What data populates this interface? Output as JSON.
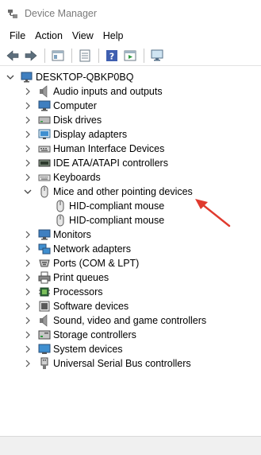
{
  "window": {
    "title": "Device Manager"
  },
  "menu": [
    "File",
    "Action",
    "View",
    "Help"
  ],
  "toolbar": {
    "buttons": [
      "back-icon",
      "forward-icon",
      "properties-panel-icon",
      "list-view-icon",
      "help-icon",
      "run-icon",
      "monitor-scan-icon"
    ]
  },
  "tree": {
    "root": "DESKTOP-QBKP0BQ",
    "categories": [
      "Audio inputs and outputs",
      "Computer",
      "Disk drives",
      "Display adapters",
      "Human Interface Devices",
      "IDE ATA/ATAPI controllers",
      "Keyboards",
      "Mice and other pointing devices",
      "Monitors",
      "Network adapters",
      "Ports (COM & LPT)",
      "Print queues",
      "Processors",
      "Software devices",
      "Sound, video and game controllers",
      "Storage controllers",
      "System devices",
      "Universal Serial Bus controllers"
    ],
    "expanded_children": [
      "HID-compliant mouse",
      "HID-compliant mouse"
    ]
  },
  "colors": {
    "annotation_arrow": "#e03a2e",
    "title_text": "#7a7a7a"
  }
}
